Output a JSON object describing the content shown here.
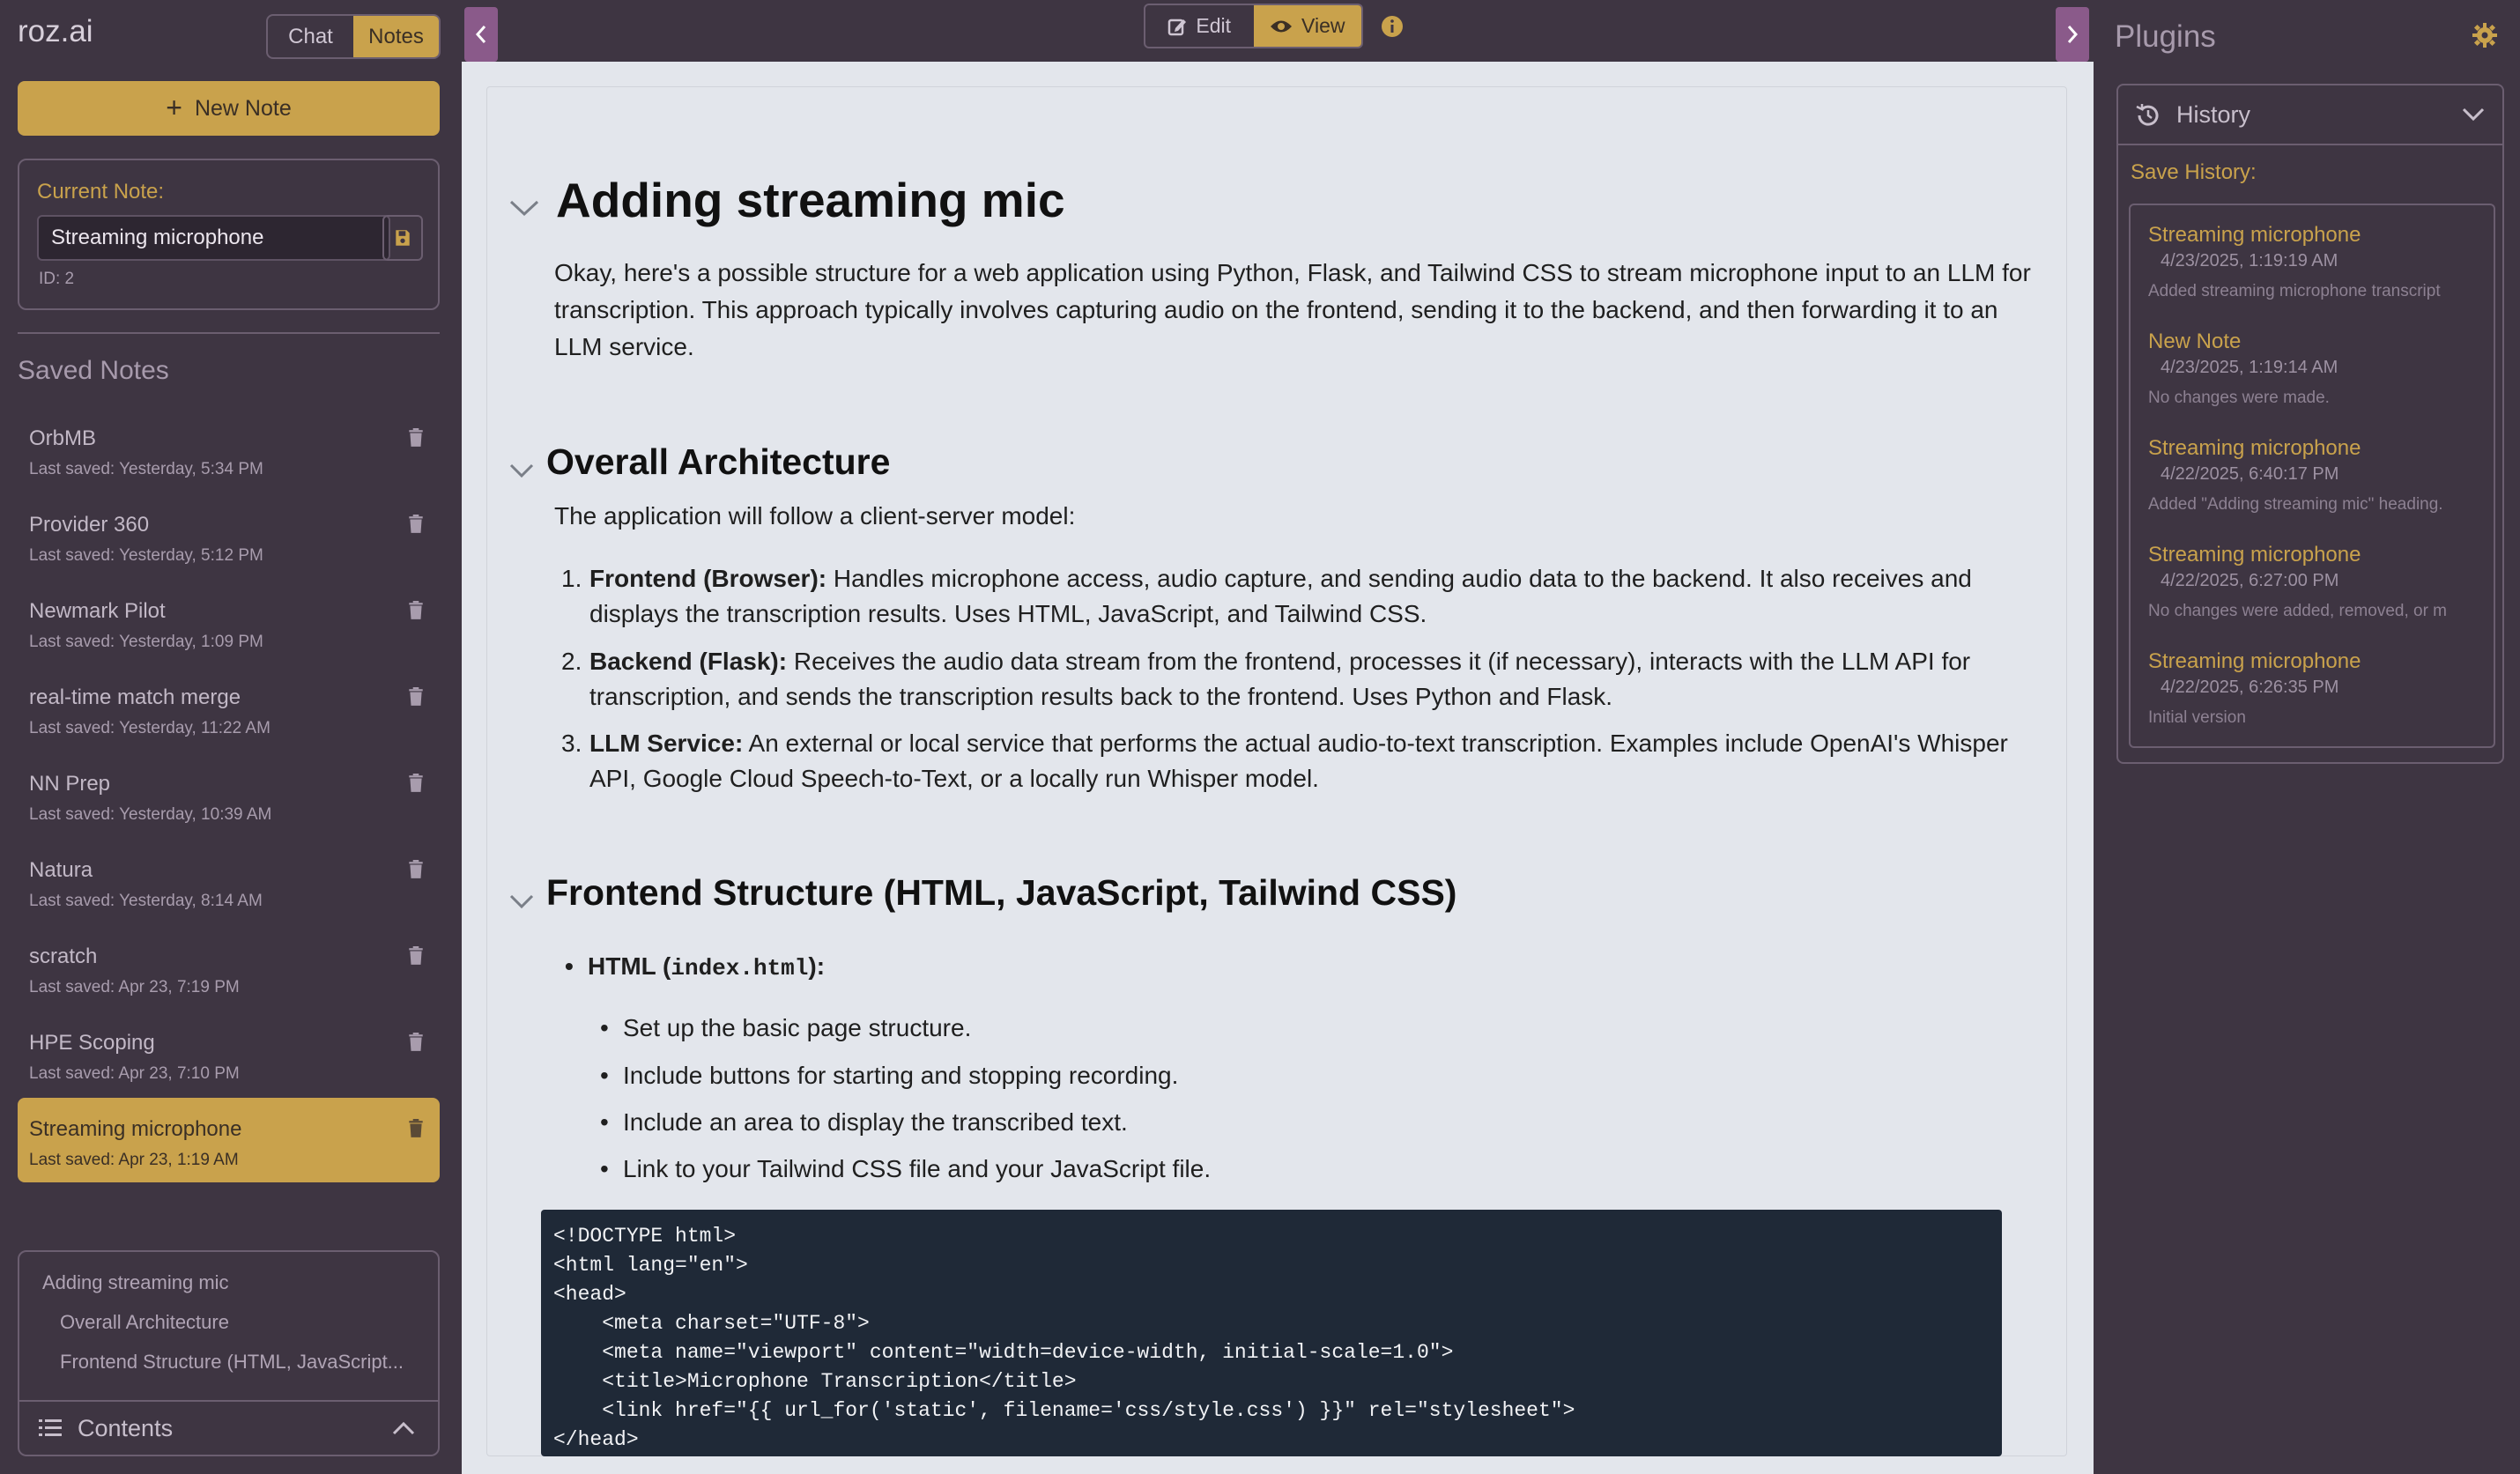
{
  "app": {
    "logo": "roz.ai"
  },
  "mode_toggle": {
    "chat": "Chat",
    "notes": "Notes"
  },
  "new_note_label": "New Note",
  "current_note": {
    "label": "Current Note:",
    "value": "Streaming microphone",
    "id": "ID: 2"
  },
  "saved_notes": {
    "title": "Saved Notes",
    "items": [
      {
        "title": "OrbMB",
        "subtitle": "Last saved: Yesterday, 5:34 PM"
      },
      {
        "title": "Provider 360",
        "subtitle": "Last saved: Yesterday, 5:12 PM"
      },
      {
        "title": "Newmark Pilot",
        "subtitle": "Last saved: Yesterday, 1:09 PM"
      },
      {
        "title": "real-time match merge",
        "subtitle": "Last saved: Yesterday, 11:22 AM"
      },
      {
        "title": "NN Prep",
        "subtitle": "Last saved: Yesterday, 10:39 AM"
      },
      {
        "title": "Natura",
        "subtitle": "Last saved: Yesterday, 8:14 AM"
      },
      {
        "title": "scratch",
        "subtitle": "Last saved: Apr 23, 7:19 PM"
      },
      {
        "title": "HPE Scoping",
        "subtitle": "Last saved: Apr 23, 7:10 PM"
      },
      {
        "title": "Streaming microphone",
        "subtitle": "Last saved: Apr 23, 1:19 AM"
      }
    ]
  },
  "contents": {
    "title": "Contents",
    "items": [
      "Adding streaming mic",
      "Overall Architecture",
      "Frontend Structure (HTML, JavaScript..."
    ]
  },
  "editor_toggle": {
    "edit": "Edit",
    "view": "View"
  },
  "document": {
    "h1": "Adding streaming mic",
    "intro": "Okay, here's a possible structure for a web application using Python, Flask, and Tailwind CSS to stream microphone input to an LLM for transcription. This approach typically involves capturing audio on the frontend, sending it to the backend, and then forwarding it to an LLM service.",
    "h2_arch": "Overall Architecture",
    "arch_intro": "The application will follow a client-server model:",
    "arch_list": [
      {
        "bold": "Frontend (Browser):",
        "text": " Handles microphone access, audio capture, and sending audio data to the backend. It also receives and displays the transcription results. Uses HTML, JavaScript, and Tailwind CSS."
      },
      {
        "bold": "Backend (Flask):",
        "text": " Receives the audio data stream from the frontend, processes it (if necessary), interacts with the LLM API for transcription, and sends the transcription results back to the frontend. Uses Python and Flask."
      },
      {
        "bold": "LLM Service:",
        "text": " An external or local service that performs the actual audio-to-text transcription. Examples include OpenAI's Whisper API, Google Cloud Speech-to-Text, or a locally run Whisper model."
      }
    ],
    "h2_frontend": "Frontend Structure (HTML, JavaScript, Tailwind CSS)",
    "html_bullet_prefix": "HTML (",
    "html_bullet_code": "index.html",
    "html_bullet_suffix": "):",
    "sub_bullets": [
      "Set up the basic page structure.",
      "Include buttons for starting and stopping recording.",
      "Include an area to display the transcribed text.",
      "Link to your Tailwind CSS file and your JavaScript file."
    ],
    "code": "<!DOCTYPE html>\n<html lang=\"en\">\n<head>\n    <meta charset=\"UTF-8\">\n    <meta name=\"viewport\" content=\"width=device-width, initial-scale=1.0\">\n    <title>Microphone Transcription</title>\n    <link href=\"{{ url_for('static', filename='css/style.css') }}\" rel=\"stylesheet\">\n</head>"
  },
  "plugins": {
    "title": "Plugins",
    "history": {
      "title": "History",
      "save_label": "Save History:",
      "items": [
        {
          "name": "Streaming microphone",
          "date": "4/23/2025, 1:19:19 AM",
          "change": "Added streaming microphone transcript"
        },
        {
          "name": "New Note",
          "date": "4/23/2025, 1:19:14 AM",
          "change": "No changes were made."
        },
        {
          "name": "Streaming microphone",
          "date": "4/22/2025, 6:40:17 PM",
          "change": "Added \"Adding streaming mic\" heading."
        },
        {
          "name": "Streaming microphone",
          "date": "4/22/2025, 6:27:00 PM",
          "change": "No changes were added, removed, or m"
        },
        {
          "name": "Streaming microphone",
          "date": "4/22/2025, 6:26:35 PM",
          "change": "Initial version"
        }
      ]
    }
  },
  "colors": {
    "accent": "#c9a24c",
    "sidebar_bg": "#3e3542",
    "content_bg": "#e3e6ec",
    "code_bg": "#1f2937"
  }
}
